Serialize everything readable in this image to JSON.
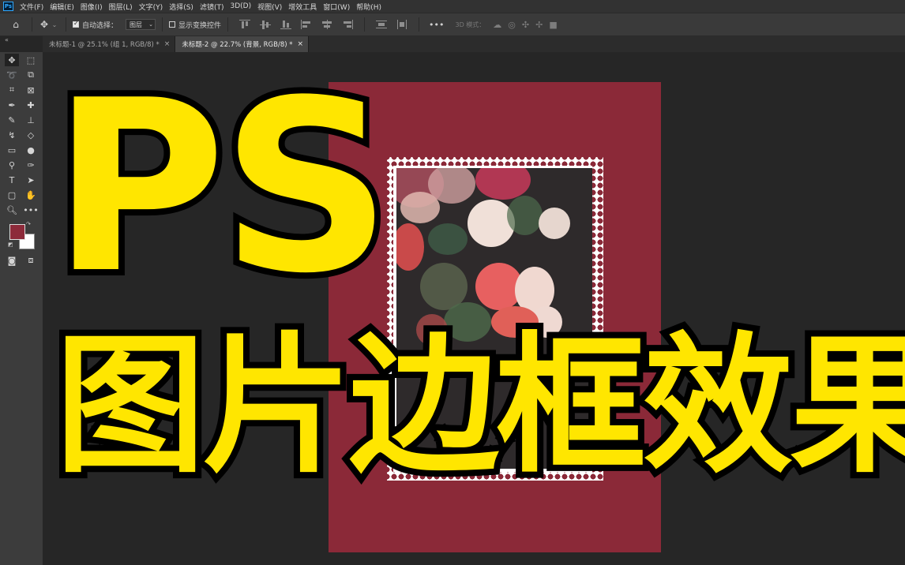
{
  "app": {
    "logo_text": "Ps",
    "menu": [
      "文件(F)",
      "编辑(E)",
      "图像(I)",
      "图层(L)",
      "文字(Y)",
      "选择(S)",
      "滤镜(T)",
      "3D(D)",
      "视图(V)",
      "增效工具",
      "窗口(W)",
      "帮助(H)"
    ]
  },
  "options_bar": {
    "home_icon": "home-icon",
    "move_icon": "move-tool-icon",
    "auto_select_label": "自动选择：",
    "auto_select_checked": true,
    "auto_select_target": "图层",
    "show_transform_label": "显示变换控件",
    "show_transform_checked": false,
    "more_label": "•••",
    "mode_label": "3D 模式："
  },
  "tabs": [
    {
      "label": "未标题-1 @ 25.1% (组 1, RGB/8) *",
      "active": false
    },
    {
      "label": "未标题-2 @ 22.7% (背景, RGB/8) *",
      "active": true
    }
  ],
  "tools": {
    "foreground_color": "#8d2a3a",
    "background_color": "#ffffff"
  },
  "canvas": {
    "document_color": "#8b2938"
  },
  "overlay": {
    "title_line1": "PS",
    "title_line2": "图片边框效果",
    "text_color": "#ffe600",
    "stroke_color": "#000000"
  }
}
